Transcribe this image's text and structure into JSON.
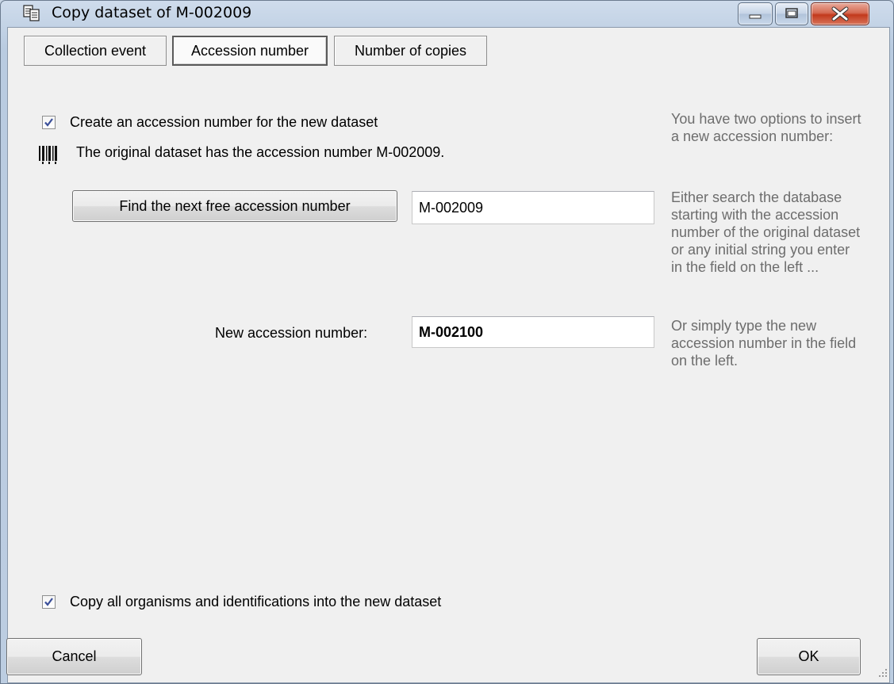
{
  "window": {
    "title": "Copy dataset of M-002009"
  },
  "tabs": [
    {
      "label": "Collection event",
      "active": false
    },
    {
      "label": "Accession number",
      "active": true
    },
    {
      "label": "Number of copies",
      "active": false
    }
  ],
  "accession": {
    "create_checkbox_label": "Create an accession number for the new dataset",
    "create_checked": true,
    "original_info": "The original dataset has the accession number M-002009.",
    "find_button_label": "Find the next free accession number",
    "search_value": "M-002009",
    "new_label": "New accession number:",
    "new_value": "M-002100"
  },
  "hints": {
    "intro": "You have two options to insert a new accession number:",
    "search": "Either search the database starting with the accession number of the original dataset or any initial string you enter in the field on the left ...",
    "type": "Or simply type the new accession number in the field on the left."
  },
  "footer": {
    "copy_checkbox_label": "Copy all organisms and identifications into the new dataset",
    "copy_checked": true,
    "cancel_label": "Cancel",
    "ok_label": "OK"
  },
  "icons": {
    "title": "copy-dataset-icon",
    "barcode": "barcode-icon",
    "minimize": "minimize-icon",
    "maximize": "maximize-icon",
    "close": "close-icon"
  }
}
